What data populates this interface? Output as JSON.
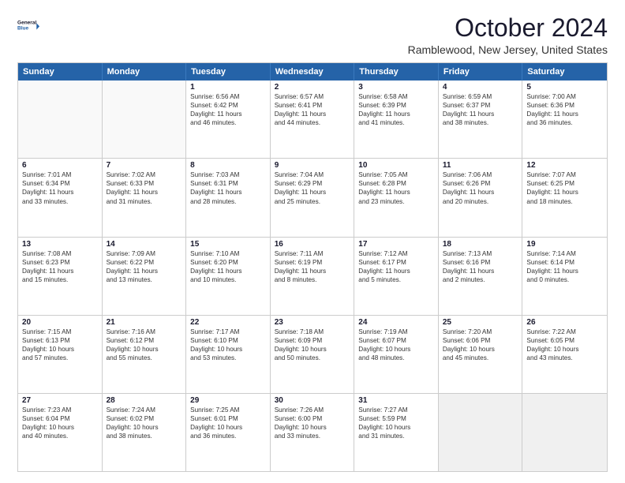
{
  "logo": {
    "line1": "General",
    "line2": "Blue"
  },
  "title": "October 2024",
  "location": "Ramblewood, New Jersey, United States",
  "weekdays": [
    "Sunday",
    "Monday",
    "Tuesday",
    "Wednesday",
    "Thursday",
    "Friday",
    "Saturday"
  ],
  "rows": [
    [
      {
        "day": "",
        "lines": [],
        "empty": true
      },
      {
        "day": "",
        "lines": [],
        "empty": true
      },
      {
        "day": "1",
        "lines": [
          "Sunrise: 6:56 AM",
          "Sunset: 6:42 PM",
          "Daylight: 11 hours",
          "and 46 minutes."
        ]
      },
      {
        "day": "2",
        "lines": [
          "Sunrise: 6:57 AM",
          "Sunset: 6:41 PM",
          "Daylight: 11 hours",
          "and 44 minutes."
        ]
      },
      {
        "day": "3",
        "lines": [
          "Sunrise: 6:58 AM",
          "Sunset: 6:39 PM",
          "Daylight: 11 hours",
          "and 41 minutes."
        ]
      },
      {
        "day": "4",
        "lines": [
          "Sunrise: 6:59 AM",
          "Sunset: 6:37 PM",
          "Daylight: 11 hours",
          "and 38 minutes."
        ]
      },
      {
        "day": "5",
        "lines": [
          "Sunrise: 7:00 AM",
          "Sunset: 6:36 PM",
          "Daylight: 11 hours",
          "and 36 minutes."
        ]
      }
    ],
    [
      {
        "day": "6",
        "lines": [
          "Sunrise: 7:01 AM",
          "Sunset: 6:34 PM",
          "Daylight: 11 hours",
          "and 33 minutes."
        ]
      },
      {
        "day": "7",
        "lines": [
          "Sunrise: 7:02 AM",
          "Sunset: 6:33 PM",
          "Daylight: 11 hours",
          "and 31 minutes."
        ]
      },
      {
        "day": "8",
        "lines": [
          "Sunrise: 7:03 AM",
          "Sunset: 6:31 PM",
          "Daylight: 11 hours",
          "and 28 minutes."
        ]
      },
      {
        "day": "9",
        "lines": [
          "Sunrise: 7:04 AM",
          "Sunset: 6:29 PM",
          "Daylight: 11 hours",
          "and 25 minutes."
        ]
      },
      {
        "day": "10",
        "lines": [
          "Sunrise: 7:05 AM",
          "Sunset: 6:28 PM",
          "Daylight: 11 hours",
          "and 23 minutes."
        ]
      },
      {
        "day": "11",
        "lines": [
          "Sunrise: 7:06 AM",
          "Sunset: 6:26 PM",
          "Daylight: 11 hours",
          "and 20 minutes."
        ]
      },
      {
        "day": "12",
        "lines": [
          "Sunrise: 7:07 AM",
          "Sunset: 6:25 PM",
          "Daylight: 11 hours",
          "and 18 minutes."
        ]
      }
    ],
    [
      {
        "day": "13",
        "lines": [
          "Sunrise: 7:08 AM",
          "Sunset: 6:23 PM",
          "Daylight: 11 hours",
          "and 15 minutes."
        ]
      },
      {
        "day": "14",
        "lines": [
          "Sunrise: 7:09 AM",
          "Sunset: 6:22 PM",
          "Daylight: 11 hours",
          "and 13 minutes."
        ]
      },
      {
        "day": "15",
        "lines": [
          "Sunrise: 7:10 AM",
          "Sunset: 6:20 PM",
          "Daylight: 11 hours",
          "and 10 minutes."
        ]
      },
      {
        "day": "16",
        "lines": [
          "Sunrise: 7:11 AM",
          "Sunset: 6:19 PM",
          "Daylight: 11 hours",
          "and 8 minutes."
        ]
      },
      {
        "day": "17",
        "lines": [
          "Sunrise: 7:12 AM",
          "Sunset: 6:17 PM",
          "Daylight: 11 hours",
          "and 5 minutes."
        ]
      },
      {
        "day": "18",
        "lines": [
          "Sunrise: 7:13 AM",
          "Sunset: 6:16 PM",
          "Daylight: 11 hours",
          "and 2 minutes."
        ]
      },
      {
        "day": "19",
        "lines": [
          "Sunrise: 7:14 AM",
          "Sunset: 6:14 PM",
          "Daylight: 11 hours",
          "and 0 minutes."
        ]
      }
    ],
    [
      {
        "day": "20",
        "lines": [
          "Sunrise: 7:15 AM",
          "Sunset: 6:13 PM",
          "Daylight: 10 hours",
          "and 57 minutes."
        ]
      },
      {
        "day": "21",
        "lines": [
          "Sunrise: 7:16 AM",
          "Sunset: 6:12 PM",
          "Daylight: 10 hours",
          "and 55 minutes."
        ]
      },
      {
        "day": "22",
        "lines": [
          "Sunrise: 7:17 AM",
          "Sunset: 6:10 PM",
          "Daylight: 10 hours",
          "and 53 minutes."
        ]
      },
      {
        "day": "23",
        "lines": [
          "Sunrise: 7:18 AM",
          "Sunset: 6:09 PM",
          "Daylight: 10 hours",
          "and 50 minutes."
        ]
      },
      {
        "day": "24",
        "lines": [
          "Sunrise: 7:19 AM",
          "Sunset: 6:07 PM",
          "Daylight: 10 hours",
          "and 48 minutes."
        ]
      },
      {
        "day": "25",
        "lines": [
          "Sunrise: 7:20 AM",
          "Sunset: 6:06 PM",
          "Daylight: 10 hours",
          "and 45 minutes."
        ]
      },
      {
        "day": "26",
        "lines": [
          "Sunrise: 7:22 AM",
          "Sunset: 6:05 PM",
          "Daylight: 10 hours",
          "and 43 minutes."
        ]
      }
    ],
    [
      {
        "day": "27",
        "lines": [
          "Sunrise: 7:23 AM",
          "Sunset: 6:04 PM",
          "Daylight: 10 hours",
          "and 40 minutes."
        ]
      },
      {
        "day": "28",
        "lines": [
          "Sunrise: 7:24 AM",
          "Sunset: 6:02 PM",
          "Daylight: 10 hours",
          "and 38 minutes."
        ]
      },
      {
        "day": "29",
        "lines": [
          "Sunrise: 7:25 AM",
          "Sunset: 6:01 PM",
          "Daylight: 10 hours",
          "and 36 minutes."
        ]
      },
      {
        "day": "30",
        "lines": [
          "Sunrise: 7:26 AM",
          "Sunset: 6:00 PM",
          "Daylight: 10 hours",
          "and 33 minutes."
        ]
      },
      {
        "day": "31",
        "lines": [
          "Sunrise: 7:27 AM",
          "Sunset: 5:59 PM",
          "Daylight: 10 hours",
          "and 31 minutes."
        ]
      },
      {
        "day": "",
        "lines": [],
        "empty": true,
        "shaded": true
      },
      {
        "day": "",
        "lines": [],
        "empty": true,
        "shaded": true
      }
    ]
  ]
}
